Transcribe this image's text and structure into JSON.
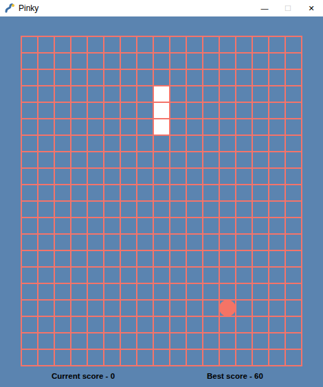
{
  "window": {
    "title": "Pinky",
    "controls": [
      {
        "label": "—",
        "disabled": false
      },
      {
        "label": "☐",
        "disabled": true
      },
      {
        "label": "✕",
        "disabled": false
      }
    ]
  },
  "snake": [
    {
      "col": 8,
      "row": 3
    },
    {
      "col": 8,
      "row": 4
    },
    {
      "col": 8,
      "row": 5
    }
  ],
  "food": {
    "col": 12,
    "row": 16
  },
  "score": {
    "current": "Current score - 0",
    "best": "Best score - 60"
  }
}
